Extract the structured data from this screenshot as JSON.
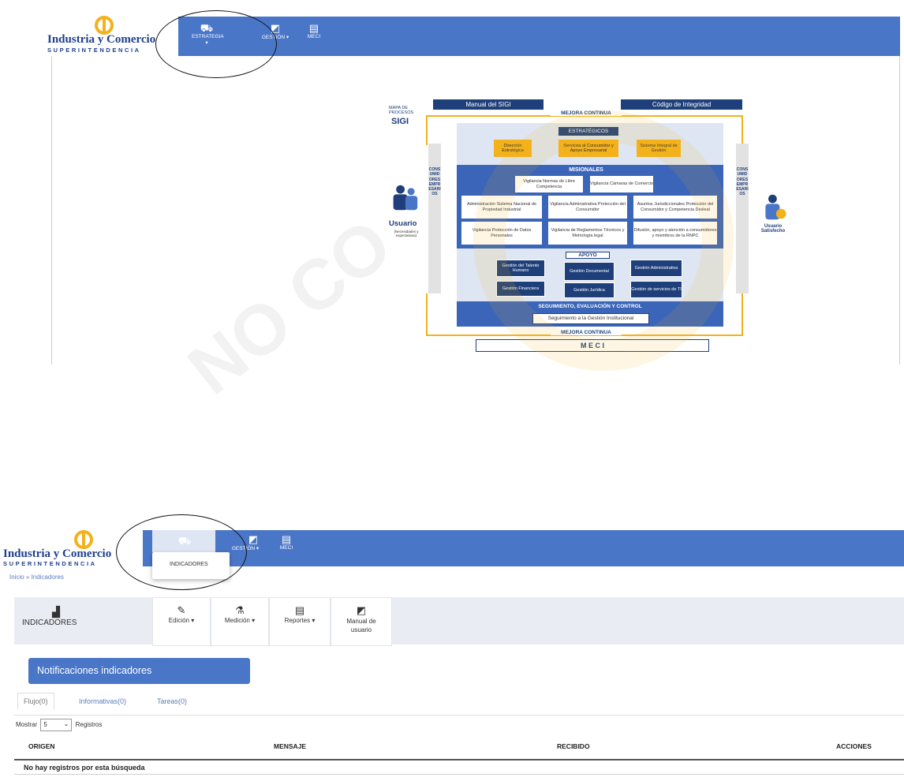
{
  "top_screen": {
    "brand": {
      "name": "Industria y Comercio",
      "sub": "SUPERINTENDENCIA"
    },
    "nav": [
      {
        "label": "ESTRATEGIA ▾",
        "icon": "strategy-icon"
      },
      {
        "label": "GESTIÓN ▾",
        "icon": "management-icon"
      },
      {
        "label": "MECI",
        "icon": "meci-icon"
      }
    ],
    "process_map": {
      "title_small": "MAPA DE\nPROCESOS",
      "title_big": "SIGI",
      "manual": "Manual del SIGI",
      "codigo": "Código de Integridad",
      "mejora_top": "MEJORA CONTINUA",
      "estrategicos": "ESTRATÉGICOS",
      "estrategicos_items": [
        "Dirección Estratégica",
        "Servicios al Consumidor y Apoyo Empresarial",
        "Sistema Integral de Gestión"
      ],
      "misionales": "MISIONALES",
      "misionales_items": [
        "Vigilancia Normas de Libre Competencia",
        "Vigilancia Cámaras de Comercio",
        "Administración Sistema Nacional de Propiedad Industrial",
        "Vigilancia Administrativa Protección del Consumidor",
        "Asuntos Jurisdiccionales Protección del Consumidor y Competencia Desleal",
        "Vigilancia Protección de Datos Personales",
        "Vigilancia de Reglamentos Técnicos y Metrología legal",
        "Difusión, apoyo y atención a consumidores y miembros de la RNPC"
      ],
      "apoyo": "APOYO",
      "apoyo_items": [
        "Gestión del Talento Humano",
        "Gestión Documental",
        "Gestión Administrativa",
        "Gestión Financiera",
        "Gestión Jurídica",
        "Gestión de servicios de TI"
      ],
      "seguimiento": "SEGUIMIENTO, EVALUACIÓN Y CONTROL",
      "seguimiento_item": "Seguimiento a la Gestión Institucional",
      "mejora_bottom": "MEJORA CONTINUA",
      "meci": "M E C I",
      "side_left": "CONSUMIDORES EMPRESARIOS",
      "side_right": "CONSUMIDORES EMPRESARIOS",
      "usuario": "Usuario",
      "usuario_sub": "(Necesidades y expectativas)",
      "usuario_sat": "Usuario Satisfecho"
    }
  },
  "bottom_screen": {
    "brand": {
      "name": "Industria y Comercio",
      "sub": "SUPERINTENDENCIA"
    },
    "nav": [
      {
        "label": "GESTIÓN ▾",
        "icon": "management-icon"
      },
      {
        "label": "MECI",
        "icon": "meci-icon"
      }
    ],
    "dropdown_item": "INDICADORES",
    "breadcrumb": "Inicio » Indicadores",
    "module_label": "INDICADORES",
    "toolbar": [
      {
        "label": "Edición ▾",
        "icon": "edit-icon"
      },
      {
        "label": "Medición ▾",
        "icon": "measure-icon"
      },
      {
        "label": "Reportes ▾",
        "icon": "reports-icon"
      },
      {
        "label": "Manual de usuario",
        "icon": "manual-icon"
      }
    ],
    "notifications_title": "Notificaciones indicadores",
    "tabs": [
      "Flujo(0)",
      "Informativas(0)",
      "Tareas(0)"
    ],
    "show": {
      "prefix": "Mostrar",
      "value": "5",
      "suffix": "Registros"
    },
    "table": {
      "headers": [
        "ORIGEN",
        "MENSAJE",
        "RECIBIDO",
        "ACCIONES"
      ],
      "empty_message": "No hay registros por esta búsqueda"
    }
  },
  "colors": {
    "nav_blue": "#4a76c8",
    "navy": "#1f3f7a",
    "gold": "#f3b11c"
  }
}
